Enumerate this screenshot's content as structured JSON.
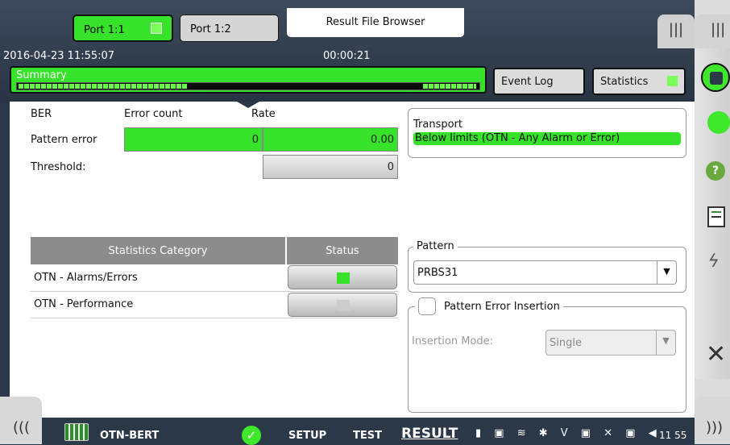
{
  "header": {
    "port1_label": "Port 1:1",
    "port2_label": "Port 1:2",
    "result_file_browser": "Result File Browser",
    "datetime": "2016-04-23 11:55:07",
    "elapsed": "00:00:21",
    "top_menu_icon": "|||",
    "summary_label": "Summary",
    "event_log_label": "Event Log",
    "statistics_label": "Statistics"
  },
  "ber": {
    "section_label": "BER",
    "error_count_header": "Error count",
    "rate_header": "Rate",
    "pattern_error_label": "Pattern error",
    "pattern_error_count": "0",
    "pattern_error_rate": "0.00",
    "threshold_label": "Threshold:",
    "threshold_value": "0"
  },
  "transport": {
    "title": "Transport",
    "status": "Below limits (OTN - Any Alarm or Error)"
  },
  "stats_table": {
    "col_category": "Statistics Category",
    "col_status": "Status",
    "rows": [
      {
        "category": "OTN - Alarms/Errors",
        "status_color": "#36e22a"
      },
      {
        "category": "OTN - Performance",
        "status_color": "#cccccc"
      }
    ]
  },
  "pattern": {
    "legend": "Pattern",
    "value": "PRBS31"
  },
  "insertion": {
    "legend": "Pattern Error Insertion",
    "mode_label": "Insertion Mode:",
    "mode_value": "Single"
  },
  "bottom_bar": {
    "left_icon": "(((",
    "right_icon": ")))",
    "app_name": "OTN-BERT",
    "setup": "SETUP",
    "test": "TEST",
    "result": "RESULT",
    "tray_icons": "▮ ▣ ≋ ✱ V ▣ ✕ ▣ ◀",
    "clock": "11 55"
  },
  "sidebar": {
    "top_icon": "|||",
    "icons": [
      "stop-icon",
      "green-status-icon",
      "help-icon",
      "report-icon",
      "lightning-icon",
      "close-icon"
    ]
  }
}
